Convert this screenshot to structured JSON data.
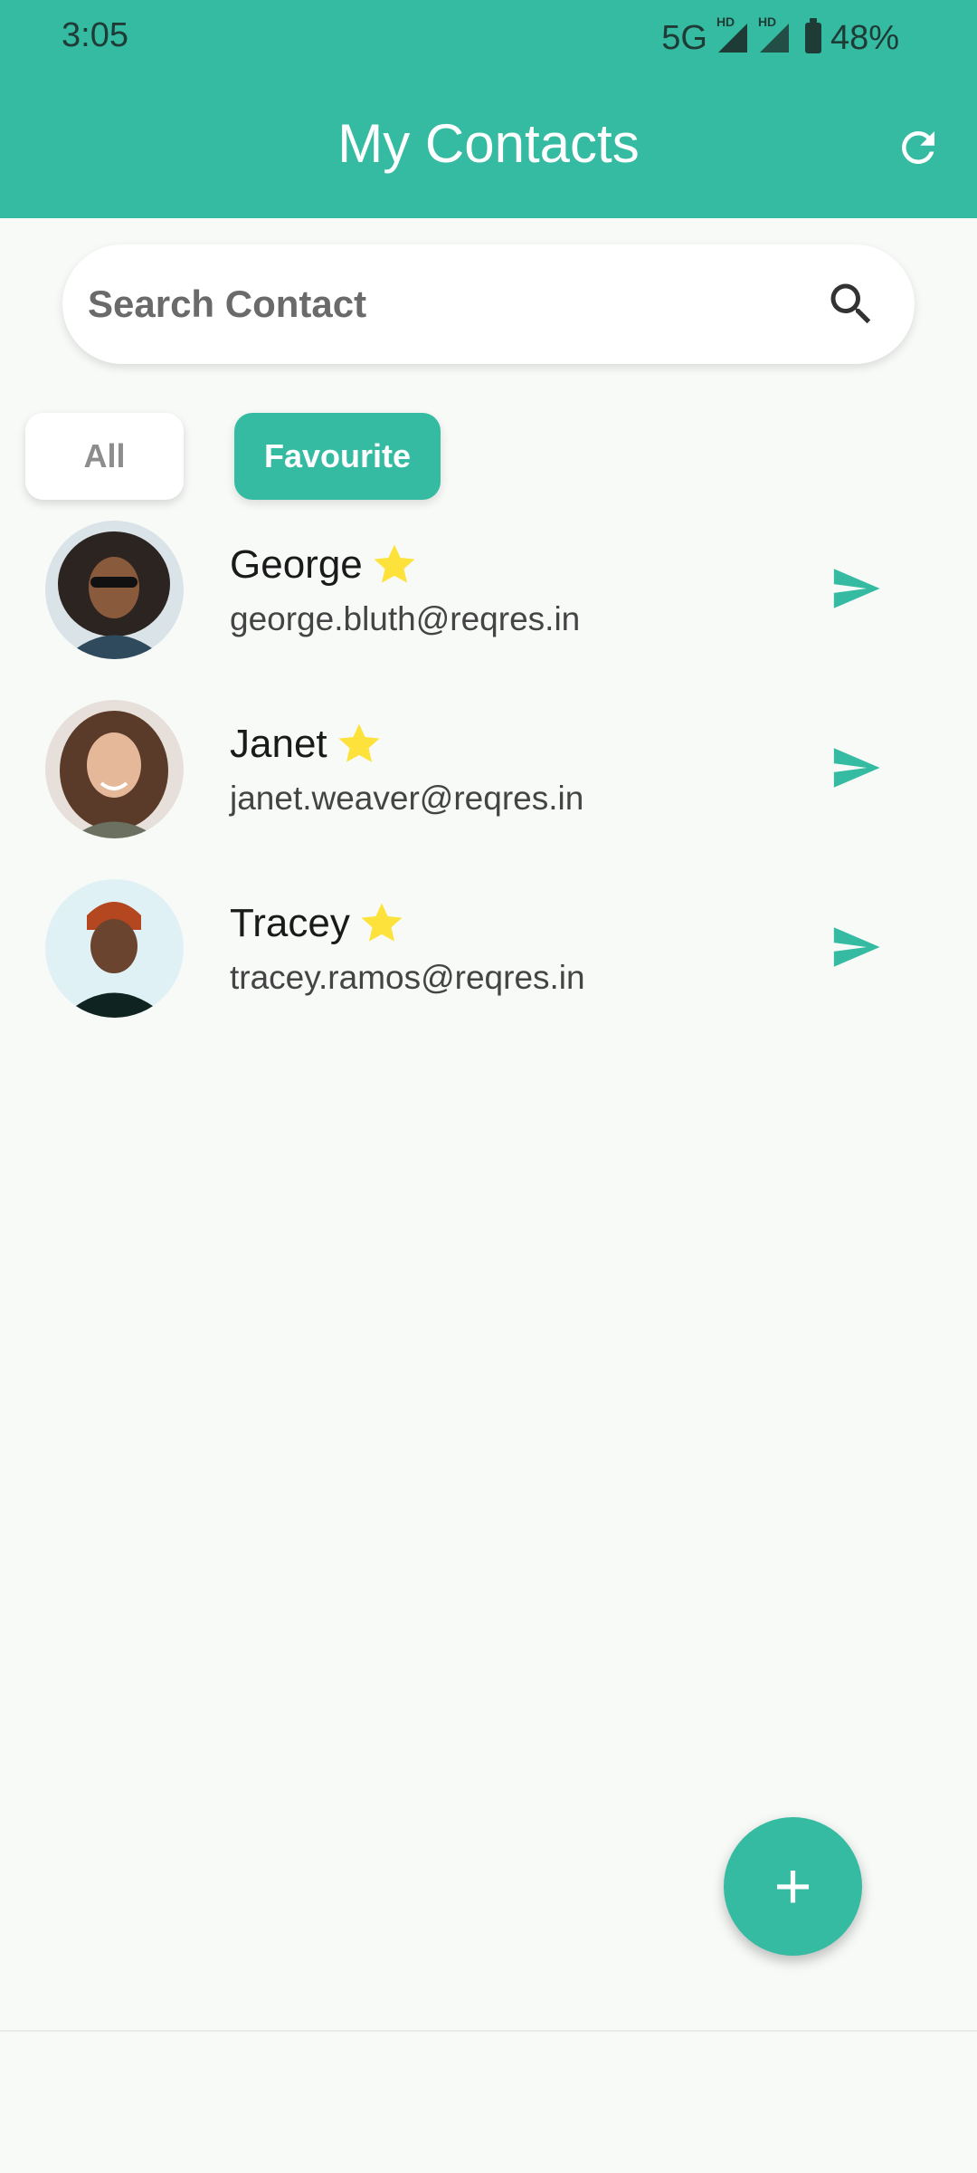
{
  "status_bar": {
    "time": "3:05",
    "network": "5G",
    "hd_label": "HD",
    "battery": "48%"
  },
  "app_bar": {
    "title": "My Contacts",
    "refresh_icon": "refresh-icon"
  },
  "search": {
    "placeholder": "Search Contact",
    "value": "",
    "icon": "search-icon"
  },
  "tabs": [
    {
      "label": "All",
      "selected": false
    },
    {
      "label": "Favourite",
      "selected": true
    }
  ],
  "contacts": [
    {
      "name": "George",
      "email": "george.bluth@reqres.in",
      "favourite": true
    },
    {
      "name": "Janet",
      "email": "janet.weaver@reqres.in",
      "favourite": true
    },
    {
      "name": "Tracey",
      "email": "tracey.ramos@reqres.in",
      "favourite": true
    }
  ],
  "fab": {
    "label": "+",
    "icon": "plus-icon"
  },
  "colors": {
    "primary": "#35bba2",
    "star": "#fde23b",
    "background": "#f8faf8"
  }
}
